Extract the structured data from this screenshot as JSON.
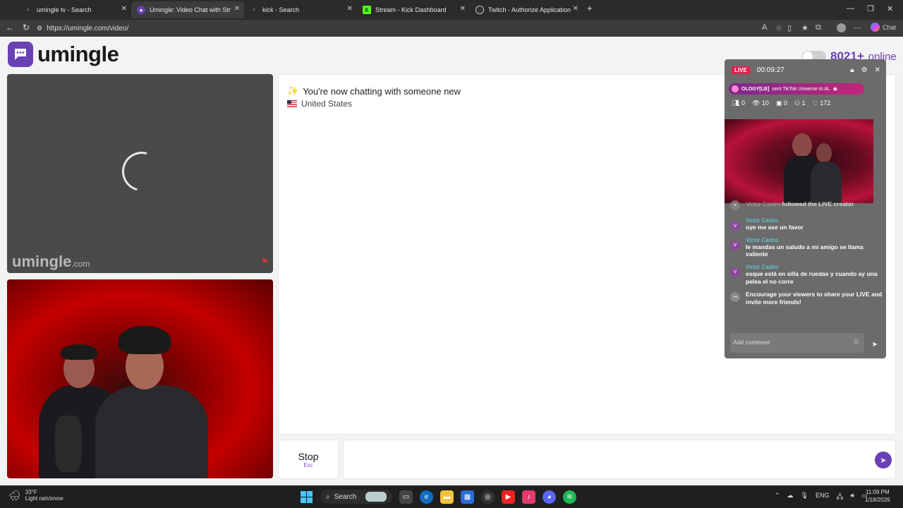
{
  "browser": {
    "tabs": [
      {
        "label": "umingle tv - Search",
        "icon": "search-icon",
        "active": false
      },
      {
        "label": "Umingle: Video Chat with Str",
        "icon": "umingle-icon",
        "active": true
      },
      {
        "label": "kick - Search",
        "icon": "search-icon",
        "active": false
      },
      {
        "label": "Stream - Kick Dashboard",
        "icon": "kick-icon",
        "active": false
      },
      {
        "label": "Twitch - Authorize Application",
        "icon": "globe-icon",
        "active": false
      }
    ],
    "url": "https://umingle.com/video/",
    "chat_label": "Chat"
  },
  "header": {
    "logo_text": "umingle",
    "online_count": "8021+",
    "online_label": "online"
  },
  "video": {
    "watermark_main": "umingle",
    "watermark_tld": ".com"
  },
  "chat": {
    "status_message": "You're now chatting with someone new",
    "country": "United States"
  },
  "controls": {
    "stop_label": "Stop",
    "stop_shortcut": "Esc"
  },
  "tiktok": {
    "live_badge": "LIVE",
    "timer": "00:09:27",
    "gift_user": "OLOGY[LB]",
    "gift_text": "sent TikTok Universe to AL",
    "stats": {
      "viewers": "0",
      "views": "10",
      "gifts": "0",
      "joins": "1",
      "likes": "172"
    },
    "follow_event": {
      "name": "Victor Castro",
      "text": "followed the LIVE creator"
    },
    "comments": [
      {
        "avatar": "V",
        "name": "Victor Castro",
        "text": "oye me ase un favor"
      },
      {
        "avatar": "V",
        "name": "Victor Castro",
        "text": "le mandas un saludo a mi amigo se llama valiente"
      },
      {
        "avatar": "V",
        "name": "Victor Castro",
        "text": "esque está en silla de ruedas y cuando ay una pelea el no corre"
      }
    ],
    "share_prompt": "Encourage your viewers to share your LIVE and invite more friends!",
    "add_comment_placeholder": "Add comment"
  },
  "taskbar": {
    "temperature": "33°F",
    "weather": "Light rain/snow",
    "search_label": "Search",
    "language": "ENG",
    "time": "11:09 PM",
    "date": "1/18/2026"
  },
  "colors": {
    "brand": "#6a40b5",
    "live": "#e81c4f",
    "comment_name": "#5ee0e8"
  }
}
